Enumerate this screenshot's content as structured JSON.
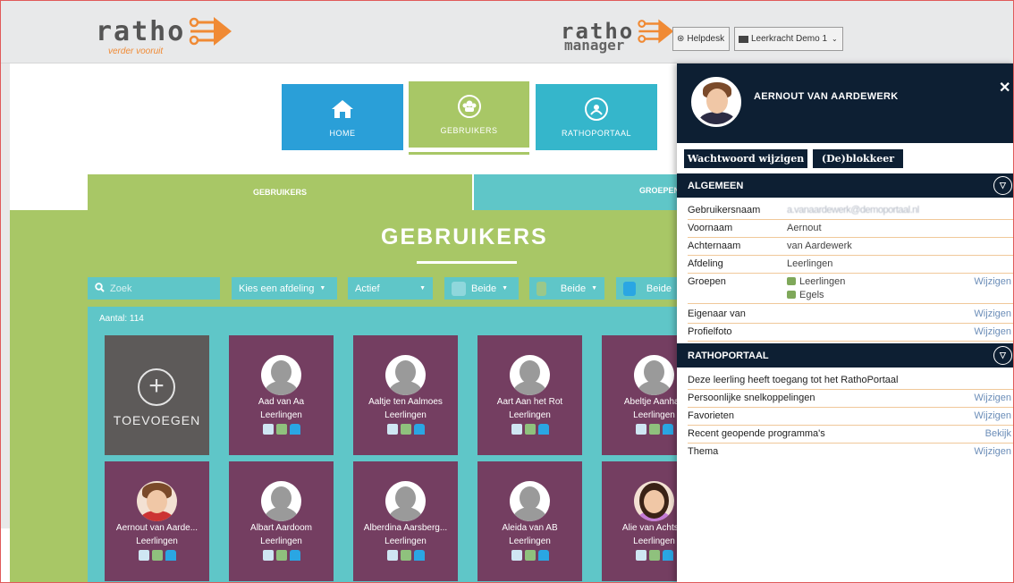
{
  "topbar": {
    "logo_word": "ratho",
    "logo_tagline": "verder vooruit",
    "manager_word": "ratho",
    "manager_sub": "manager",
    "helpdesk_label": "Helpdesk",
    "user_label": "Leerkracht Demo 1"
  },
  "tiles": [
    {
      "label": "HOME",
      "icon": "home-icon",
      "color": "#2a9fd8"
    },
    {
      "label": "GEBRUIKERS",
      "icon": "users-icon",
      "color": "#a8c766"
    },
    {
      "label": "RATHOPORTAAL",
      "icon": "portal-icon",
      "color": "#35b6cb"
    }
  ],
  "tabs": [
    "GEBRUIKERS",
    "GROEPEN"
  ],
  "page_title": "GEBRUIKERS",
  "filters": {
    "search_placeholder": "Zoek",
    "afdeling": "Kies een afdeling",
    "status": "Actief",
    "beide1": "Beide",
    "beide2": "Beide",
    "beide3": "Beide"
  },
  "aantal": "Aantal: 114",
  "add_label": "TOEVOEGEN",
  "cards": [
    {
      "name": "Aad van Aa",
      "group": "Leerlingen",
      "photo": false
    },
    {
      "name": "Aaltje ten Aalmoes",
      "group": "Leerlingen",
      "photo": false
    },
    {
      "name": "Aart Aan het Rot",
      "group": "Leerlingen",
      "photo": false
    },
    {
      "name": "Abeltje Aanhaa",
      "group": "Leerlingen",
      "photo": false
    },
    {
      "name": "Aernout van Aarde...",
      "group": "Leerlingen",
      "photo": "boy"
    },
    {
      "name": "Albart Aardoom",
      "group": "Leerlingen",
      "photo": false
    },
    {
      "name": "Alberdina Aarsberg...",
      "group": "Leerlingen",
      "photo": false
    },
    {
      "name": "Aleida van AB",
      "group": "Leerlingen",
      "photo": false
    },
    {
      "name": "Alie van Achtste",
      "group": "Leerlingen",
      "photo": "girl"
    }
  ],
  "panel": {
    "name": "AERNOUT VAN AARDEWERK",
    "btn_password": "Wachtwoord wijzigen",
    "btn_block": "(De)blokkeer",
    "section_general": "ALGEMEEN",
    "section_portal": "RATHOPORTAAL",
    "general_rows": [
      {
        "label": "Gebruikersnaam",
        "value": "a.vanaardewerk@demoportaal.nl",
        "action": ""
      },
      {
        "label": "Voornaam",
        "value": "Aernout",
        "action": ""
      },
      {
        "label": "Achternaam",
        "value": "van Aardewerk",
        "action": ""
      },
      {
        "label": "Afdeling",
        "value": "Leerlingen",
        "action": ""
      },
      {
        "label": "Groepen",
        "value": "Leerlingen",
        "value2": "Egels",
        "action": "Wijzigen"
      },
      {
        "label": "Eigenaar van",
        "value": "",
        "action": "Wijzigen"
      },
      {
        "label": "Profielfoto",
        "value": "",
        "action": "Wijzigen"
      }
    ],
    "portal_rows": [
      {
        "label": "Deze leerling heeft toegang tot het RathoPortaal",
        "action": ""
      },
      {
        "label": "Persoonlijke snelkoppelingen",
        "action": "Wijzigen"
      },
      {
        "label": "Favorieten",
        "action": "Wijzigen"
      },
      {
        "label": "Recent geopende programma's",
        "action": "Bekijk"
      },
      {
        "label": "Thema",
        "action": "Wijzigen"
      }
    ]
  }
}
